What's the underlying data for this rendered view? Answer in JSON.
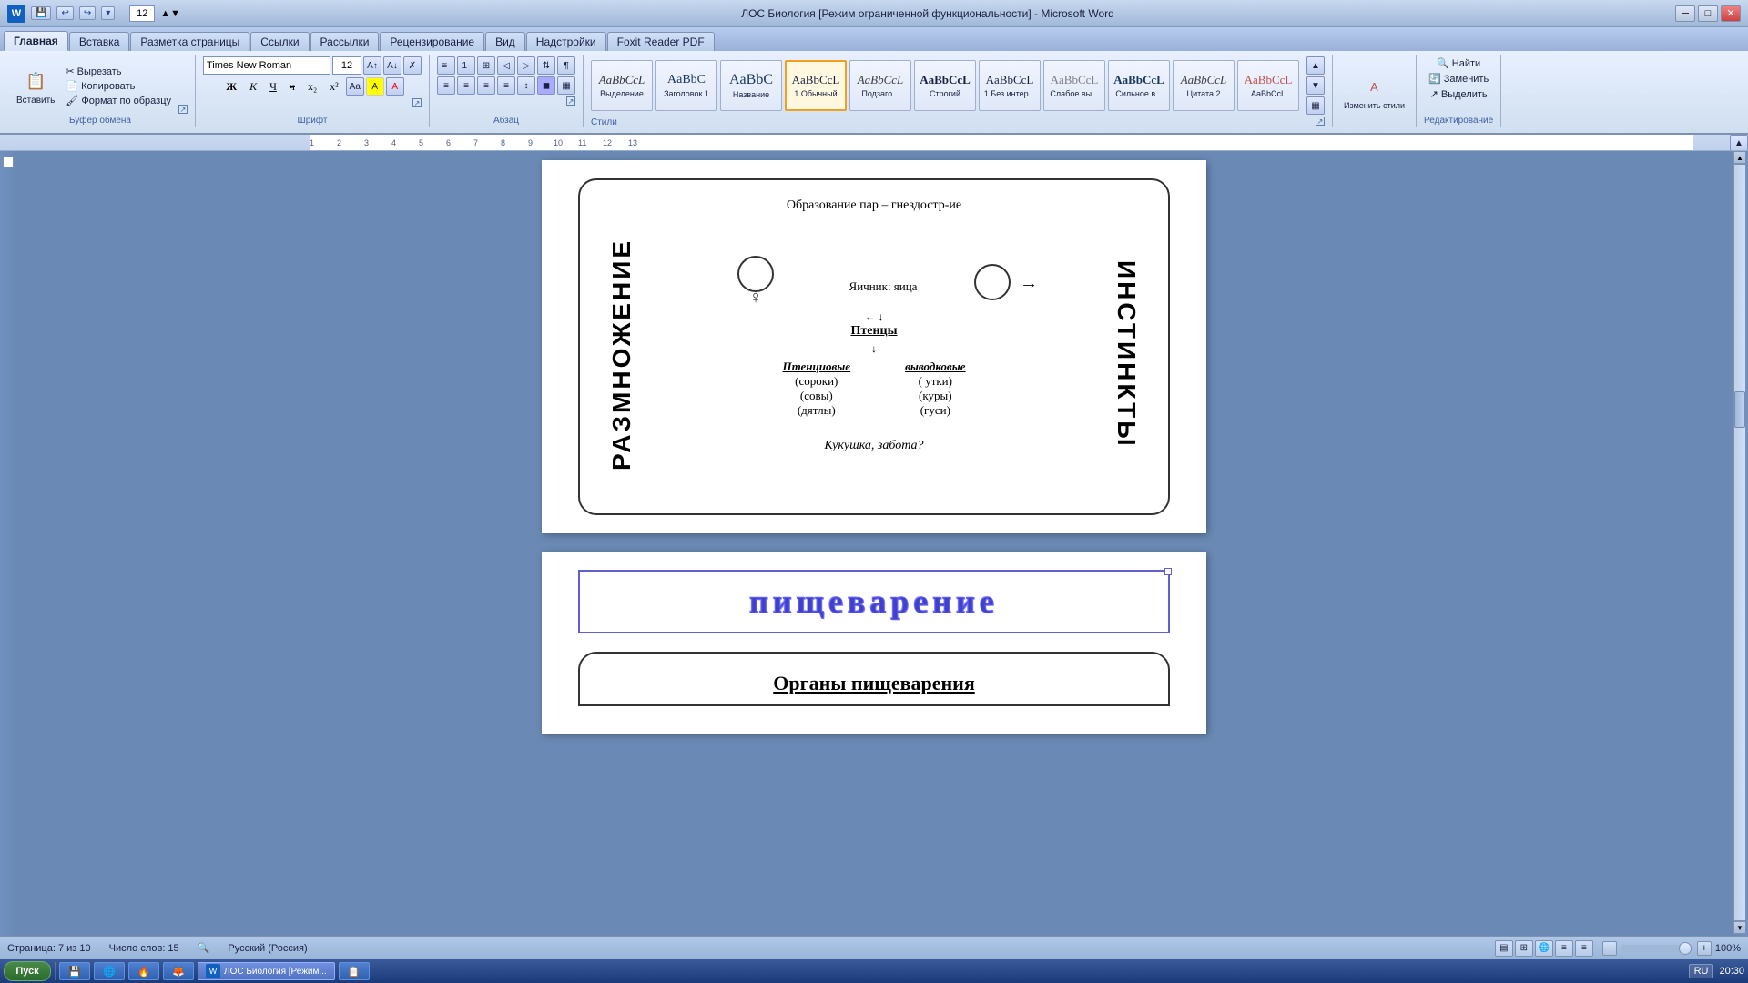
{
  "titlebar": {
    "title": "ЛОС Биология [Режим ограниченной функциональности] - Microsoft Word",
    "app_icon": "W",
    "font_size": "12",
    "btn_minimize": "─",
    "btn_maximize": "□",
    "btn_close": "✕"
  },
  "quickaccess": {
    "save": "💾",
    "undo": "↩",
    "redo": "↪"
  },
  "ribbon": {
    "tabs": [
      "Главная",
      "Вставка",
      "Разметка страницы",
      "Ссылки",
      "Рассылки",
      "Рецензирование",
      "Вид",
      "Надстройки",
      "Foxit Reader PDF"
    ],
    "active_tab": "Главная",
    "groups": {
      "clipboard": {
        "label": "Буфер обмена",
        "paste": "Вставить",
        "cut": "Вырезать",
        "copy": "Копировать",
        "format": "Формат по образцу"
      },
      "font": {
        "label": "Шрифт",
        "name": "Times New Roman",
        "size": "12",
        "bold": "Ж",
        "italic": "К",
        "underline": "Ч"
      },
      "paragraph": {
        "label": "Абзац"
      },
      "styles": {
        "label": "Стили",
        "items": [
          {
            "name": "Выделение",
            "sample": "AaBbCcL"
          },
          {
            "name": "Заголовок 1",
            "sample": "AaBbC"
          },
          {
            "name": "Название",
            "sample": "AaBbC"
          },
          {
            "name": "1 Обычный",
            "sample": "AaBbCcL",
            "active": true
          },
          {
            "name": "Подзаго...",
            "sample": "AaBbCcL"
          },
          {
            "name": "Строгий",
            "sample": "AaBbCcL"
          },
          {
            "name": "1 Без интер...",
            "sample": "AaBbCcL"
          },
          {
            "name": "Слабое вы...",
            "sample": "AaBbCcL"
          },
          {
            "name": "Сильное в...",
            "sample": "AaBbCcL"
          },
          {
            "name": "Цитата 2",
            "sample": "AaBbCcL"
          },
          {
            "name": "AaBbCcL",
            "sample": "AaBbCcL"
          }
        ],
        "change_styles": "Изменить стили"
      },
      "editing": {
        "label": "Редактирование",
        "find": "Найти",
        "replace": "Заменить",
        "select": "Выделить"
      }
    }
  },
  "document": {
    "page1": {
      "top_text": "Образование пар – гнездостр-ие",
      "left_vertical": "РАЗМНОЖЕНИЕ",
      "right_vertical": "ИНСТИНКТЫ",
      "ovary_text": "Яичник: яица",
      "chicks_text": "Птенцы",
      "nestling_type": "Птенциовые ",
      "precocial_type": "выводковые",
      "nestling_examples": [
        "(сороки)",
        "(совы)",
        "(дятлы)"
      ],
      "precocial_examples": [
        "( утки)",
        "(куры)",
        "(гуси)"
      ],
      "cuckoo_text": "Кукушка, забота?"
    },
    "page2": {
      "digestion_title": "пищеварение",
      "organs_title": "Органы пищеварения"
    }
  },
  "statusbar": {
    "page_info": "Страница: 7 из 10",
    "word_count": "Число слов: 15",
    "lang": "Русский (Россия)",
    "zoom": "100%"
  },
  "taskbar": {
    "start_label": "Пуск",
    "active_window": "ЛОС Биология [Режим...",
    "lang_indicator": "RU",
    "time": "20:30",
    "icons": [
      "💾",
      "🌐",
      "🔥",
      "🦊",
      "📋"
    ]
  }
}
